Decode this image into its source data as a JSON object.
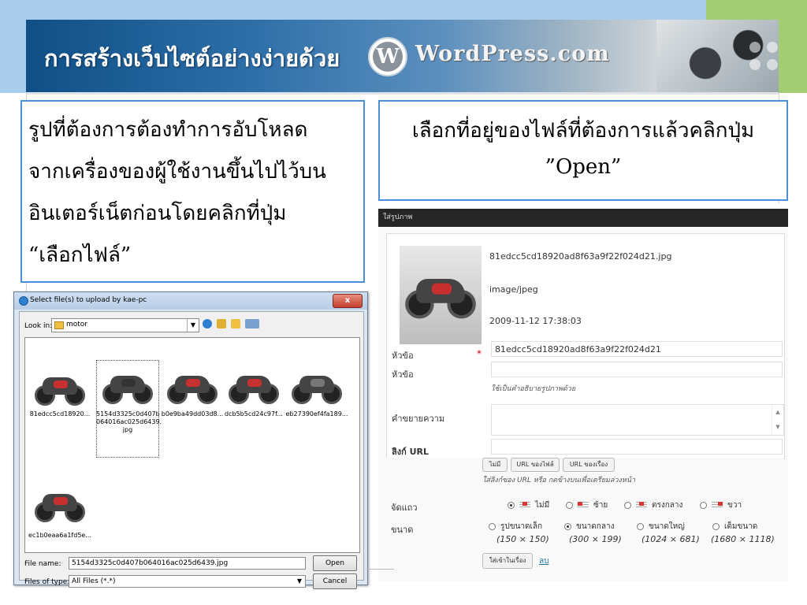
{
  "slide": {
    "title": "การสร้างเว็บไซต์อย่างง่ายด้วย",
    "logo_text": "WordPress.com",
    "left_text": [
      "รูปที่ต้องการต้องทำการอับโหลด",
      "จากเครื่องของผู้ใช้งานขึ้นไปไว้บน",
      "อินเตอร์เน็ตก่อนโดยคลิกที่ปุ่ม",
      "“เลือกไฟล์”"
    ],
    "right_text": [
      "เลือกที่อยู่ของไฟล์ที่ต้องการแล้วคลิกปุ่ม",
      "”Open”"
    ],
    "colors": {
      "accent": "#4a90d9",
      "topbar": "#a9cdea",
      "topbar_right": "#a2cd72"
    }
  },
  "dialog": {
    "title": "Select file(s) to upload by kae-pc",
    "close_label": "x",
    "look_in_label": "Look in:",
    "look_in_value": "motor",
    "files": [
      {
        "name": "81edcc5cd18920..."
      },
      {
        "name": "5154d3325c0d407b064016ac025d6439.jpg",
        "lines": [
          "5154d3325c0d407b",
          "064016ac025d6439.",
          "jpg"
        ],
        "selected": true
      },
      {
        "name": "b0e9ba49dd03d8..."
      },
      {
        "name": "dcb5b5cd24c97f..."
      },
      {
        "name": "eb27390ef4fa189..."
      },
      {
        "name": "ec1b0eaa6a1fd5e..."
      }
    ],
    "file_name_label": "File name:",
    "file_name_value": "5154d3325c0d407b064016ac025d6439.jpg",
    "file_type_label": "Files of type:",
    "file_type_value": "All Files (*.*)",
    "open_label": "Open",
    "cancel_label": "Cancel"
  },
  "wp": {
    "header": "ใส่รูปภาพ",
    "filename": "81edcc5cd18920ad8f63a9f22f024d21.jpg",
    "mime": "image/jpeg",
    "date": "2009-11-12 17:38:03",
    "title_label": "หัวข้อ",
    "title_value": "81edcc5cd18920ad8f63a9f22f024d21",
    "caption_label": "หัวข้อ",
    "caption_hint": "ใช้เป็นคำอธิบายรูปภาพด้วย",
    "description_label": "คำขยายความ",
    "link_label": "ลิงก์ URL",
    "link_buttons": [
      "ไม่มี",
      "URL ของไฟล์",
      "URL ของเรื่อง"
    ],
    "link_hint": "ใส่ลิงก์ของ URL หรือ กดข้างบนเพื่อเตรียมล่วงหน้า",
    "align_label": "จัดแถว",
    "align_options": [
      "ไม่มี",
      "ซ้าย",
      "ตรงกลาง",
      "ขวา"
    ],
    "size_label": "ขนาด",
    "size_options": [
      {
        "label": "รูปขนาดเล็ก",
        "dim": "(150 × 150)"
      },
      {
        "label": "ขนาดกลาง",
        "dim": "(300 × 199)"
      },
      {
        "label": "ขนาดใหญ่",
        "dim": "(1024 × 681)"
      },
      {
        "label": "เต็มขนาด",
        "dim": "(1680 × 1118)"
      }
    ],
    "insert_label": "ใส่เข้าในเรื่อง",
    "delete_label": "ลบ"
  }
}
